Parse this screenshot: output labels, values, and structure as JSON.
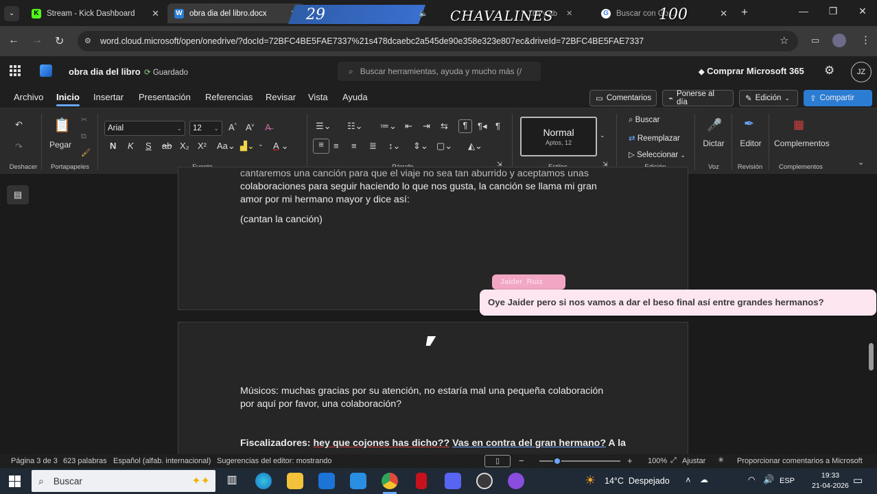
{
  "browser": {
    "tabs": [
      {
        "title": "Stream - Kick Dashboard",
        "icon": "kick-icon"
      },
      {
        "title": "obra dia del libro.docx",
        "icon": "word-icon"
      },
      {
        "title": "...ba y ab",
        "icon": "speaker-icon"
      },
      {
        "title": "Buscar con Go...",
        "icon": "google-icon"
      }
    ],
    "overlay": {
      "left_number": "29",
      "name": "CHAVALINES",
      "right_number": "100"
    },
    "url": "word.cloud.microsoft/open/onedrive/?docId=72BFC4BE5FAE7337%21s478dcaebc2a545de90e358e323e807ec&driveId=72BFC4BE5FAE7337"
  },
  "word": {
    "doc_title": "obra dia del libro",
    "save_status": "Guardado",
    "search_placeholder": "Buscar herramientas, ayuda y mucho más (/",
    "buy_label": "Comprar Microsoft 365",
    "avatar": "JZ",
    "menu": [
      "Archivo",
      "Inicio",
      "Insertar",
      "Presentación",
      "Referencias",
      "Revisar",
      "Vista",
      "Ayuda"
    ],
    "active_menu": "Inicio",
    "comments_label": "Comentarios",
    "catchup_label": "Ponerse al día",
    "editing_label": "Edición",
    "share_label": "Compartir"
  },
  "ribbon": {
    "undo_group": "Deshacer",
    "paste_label": "Pegar",
    "clipboard_group": "Portapapeles",
    "font_name": "Arial",
    "font_size": "12",
    "font_group": "Fuente",
    "bold": "N",
    "italic": "K",
    "underline": "S",
    "strike": "ab",
    "subscript": "X₂",
    "superscript": "X²",
    "paragraph_group": "Párrafo",
    "style_name": "Normal",
    "style_sub": "Aptos, 12",
    "styles_group": "Estilos",
    "find_label": "Buscar",
    "replace_label": "Reemplazar",
    "select_label": "Seleccionar",
    "editing_group": "Edición",
    "dictate_label": "Dictar",
    "voice_group": "Voz",
    "editor_label": "Editor",
    "review_group": "Revisión",
    "addins_label": "Complementos",
    "addins_group": "Complementos"
  },
  "document": {
    "page1_lines": [
      "cantaremos una canción para que el viaje no sea tan aburrido y aceptamos unas",
      "colaboraciones para seguir haciendo lo que nos gusta, la canción se llama mi gran",
      "amor por mi hermano mayor y dice así:"
    ],
    "page1_stage": "(cantan la canción)",
    "page2_musicos": [
      "Músicos: muchas gracias por su atención, no estaría mal una pequeña colaboración",
      "por aquí por favor, una colaboración?"
    ],
    "page2_fisc_prefix": "Fiscalizadores: ",
    "page2_fisc_mid": "hey que cojones has dicho??",
    "page2_fisc_link": "Vas en contra del gran hermano?",
    "page2_fisc_end": " A la"
  },
  "chat": {
    "username": "Jaider_Ruiz",
    "message": "Oye Jaider pero si nos vamos a dar el beso final así entre grandes hermanos?"
  },
  "status": {
    "page": "Página 3 de 3",
    "words": "623 palabras",
    "language": "Español (alfab. internacional)",
    "suggestions": "Sugerencias del editor: mostrando",
    "zoom": "100%",
    "fit": "Ajustar",
    "feedback": "Proporcionar comentarios a Microsoft"
  },
  "taskbar": {
    "search_placeholder": "Buscar",
    "weather": "14°C  Despejado",
    "lang": "ESP",
    "time": "19:33",
    "date": "21-04-2026"
  },
  "colors": {
    "accent": "#2b7cd3",
    "chat_bubble": "#fde6ef",
    "chat_name": "#f2a6c4"
  }
}
